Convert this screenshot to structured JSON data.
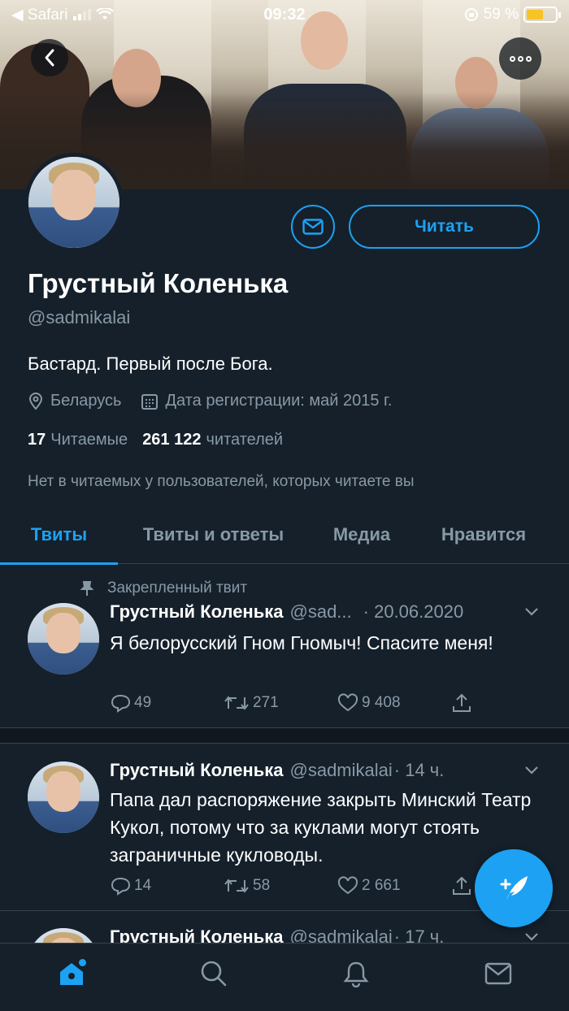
{
  "status_bar": {
    "back_app": "◀ Safari",
    "time": "09:32",
    "battery_percent": "59 %",
    "battery_level": 0.59
  },
  "profile": {
    "name": "Грустный Коленька",
    "handle": "@sadmikalai",
    "bio": "Бастард. Первый после Бога.",
    "location": "Беларусь",
    "joined": "Дата регистрации: май 2015 г.",
    "following_count": "17",
    "following_label": "Читаемые",
    "followers_count": "261 122",
    "followers_label": "читателей",
    "common_followers": "Нет в читаемых у пользователей, которых читаете вы",
    "follow_button": "Читать"
  },
  "tabs": [
    {
      "label": "Твиты",
      "active": true
    },
    {
      "label": "Твиты и ответы",
      "active": false
    },
    {
      "label": "Медиа",
      "active": false
    },
    {
      "label": "Нравится",
      "active": false
    }
  ],
  "tweets": [
    {
      "pinned_label": "Закрепленный твит",
      "author": "Грустный Коленька",
      "handle": "@sad...",
      "time": "· 20.06.2020",
      "text": "Я белорусский Гном Гномыч! Спасите меня!",
      "replies": "49",
      "retweets": "271",
      "likes": "9 408"
    },
    {
      "author": "Грустный Коленька",
      "handle": "@sadmikalai",
      "time": "· 14 ч.",
      "text": "Папа дал распоряжение закрыть Минский Театр Кукол, потому что за куклами могут стоять заграничные кукловоды.",
      "replies": "14",
      "retweets": "58",
      "likes": "2 661"
    },
    {
      "author": "Грустный Коленька",
      "handle": "@sadmikalai",
      "time": "· 17 ч."
    }
  ],
  "colors": {
    "background": "#15202b",
    "accent": "#1da1f2",
    "secondary_text": "#8899a6",
    "border": "#38444d"
  },
  "icons": [
    "back-icon",
    "more-icon",
    "mail-icon",
    "location-icon",
    "calendar-icon",
    "pin-icon",
    "reply-icon",
    "retweet-icon",
    "like-icon",
    "share-icon",
    "chevron-down-icon",
    "compose-icon",
    "home-icon",
    "search-icon",
    "notifications-icon",
    "messages-icon"
  ]
}
